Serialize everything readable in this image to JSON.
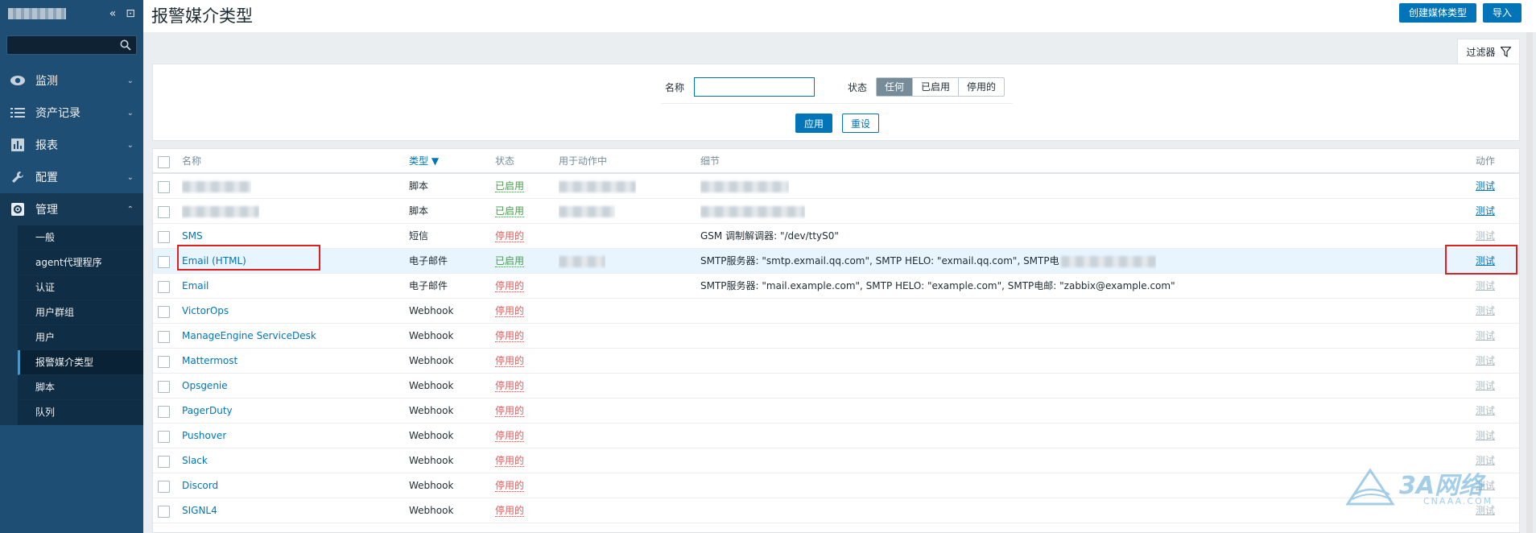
{
  "sidebar": {
    "search_placeholder": "",
    "menu": [
      {
        "label": "监测",
        "icon": "eye-icon"
      },
      {
        "label": "资产记录",
        "icon": "list-icon"
      },
      {
        "label": "报表",
        "icon": "bar-chart-icon"
      },
      {
        "label": "配置",
        "icon": "wrench-icon"
      },
      {
        "label": "管理",
        "icon": "gear-icon"
      }
    ],
    "submenu": [
      "一般",
      "agent代理程序",
      "认证",
      "用户群组",
      "用户",
      "报警媒介类型",
      "脚本",
      "队列"
    ]
  },
  "header": {
    "title": "报警媒介类型",
    "create_button": "创建媒体类型",
    "import_button": "导入"
  },
  "filter": {
    "tab_label": "过滤器",
    "name_label": "名称",
    "name_value": "",
    "status_label": "状态",
    "status_options": [
      "任何",
      "已启用",
      "停用的"
    ],
    "status_selected": "任何",
    "apply_button": "应用",
    "reset_button": "重设"
  },
  "table": {
    "columns": {
      "name": "名称",
      "type": "类型 ▼",
      "status": "状态",
      "used": "用于动作中",
      "details": "细节",
      "action": "动作"
    },
    "action_label": "测试",
    "rows": [
      {
        "name": "",
        "type": "脚本",
        "status": "已启用",
        "status_on": true,
        "details": "",
        "redacted": true
      },
      {
        "name": "",
        "type": "脚本",
        "status": "已启用",
        "status_on": true,
        "details": "",
        "redacted": true
      },
      {
        "name": "SMS",
        "type": "短信",
        "status": "停用的",
        "status_on": false,
        "details": "GSM 调制解调器: \"/dev/ttyS0\""
      },
      {
        "name": "Email (HTML)",
        "type": "电子邮件",
        "status": "已启用",
        "status_on": true,
        "details": "SMTP服务器: \"smtp.exmail.qq.com\", SMTP HELO: \"exmail.qq.com\", SMTP电",
        "redacted_detail_tail": true
      },
      {
        "name": "Email",
        "type": "电子邮件",
        "status": "停用的",
        "status_on": false,
        "details": "SMTP服务器: \"mail.example.com\", SMTP HELO: \"example.com\", SMTP电邮: \"zabbix@example.com\""
      },
      {
        "name": "VictorOps",
        "type": "Webhook",
        "status": "停用的",
        "status_on": false,
        "details": ""
      },
      {
        "name": "ManageEngine ServiceDesk",
        "type": "Webhook",
        "status": "停用的",
        "status_on": false,
        "details": ""
      },
      {
        "name": "Mattermost",
        "type": "Webhook",
        "status": "停用的",
        "status_on": false,
        "details": ""
      },
      {
        "name": "Opsgenie",
        "type": "Webhook",
        "status": "停用的",
        "status_on": false,
        "details": ""
      },
      {
        "name": "PagerDuty",
        "type": "Webhook",
        "status": "停用的",
        "status_on": false,
        "details": ""
      },
      {
        "name": "Pushover",
        "type": "Webhook",
        "status": "停用的",
        "status_on": false,
        "details": ""
      },
      {
        "name": "Slack",
        "type": "Webhook",
        "status": "停用的",
        "status_on": false,
        "details": ""
      },
      {
        "name": "Discord",
        "type": "Webhook",
        "status": "停用的",
        "status_on": false,
        "details": ""
      },
      {
        "name": "SIGNL4",
        "type": "Webhook",
        "status": "停用的",
        "status_on": false,
        "details": ""
      }
    ]
  },
  "watermark": {
    "brand": "3A网络",
    "sub": "CNAAA.COM"
  },
  "colors": {
    "sidebar": "#1f4e74",
    "accent": "#0275b8",
    "enabled": "#429e47",
    "disabled": "#e45959",
    "highlight_box": "#e02020"
  }
}
